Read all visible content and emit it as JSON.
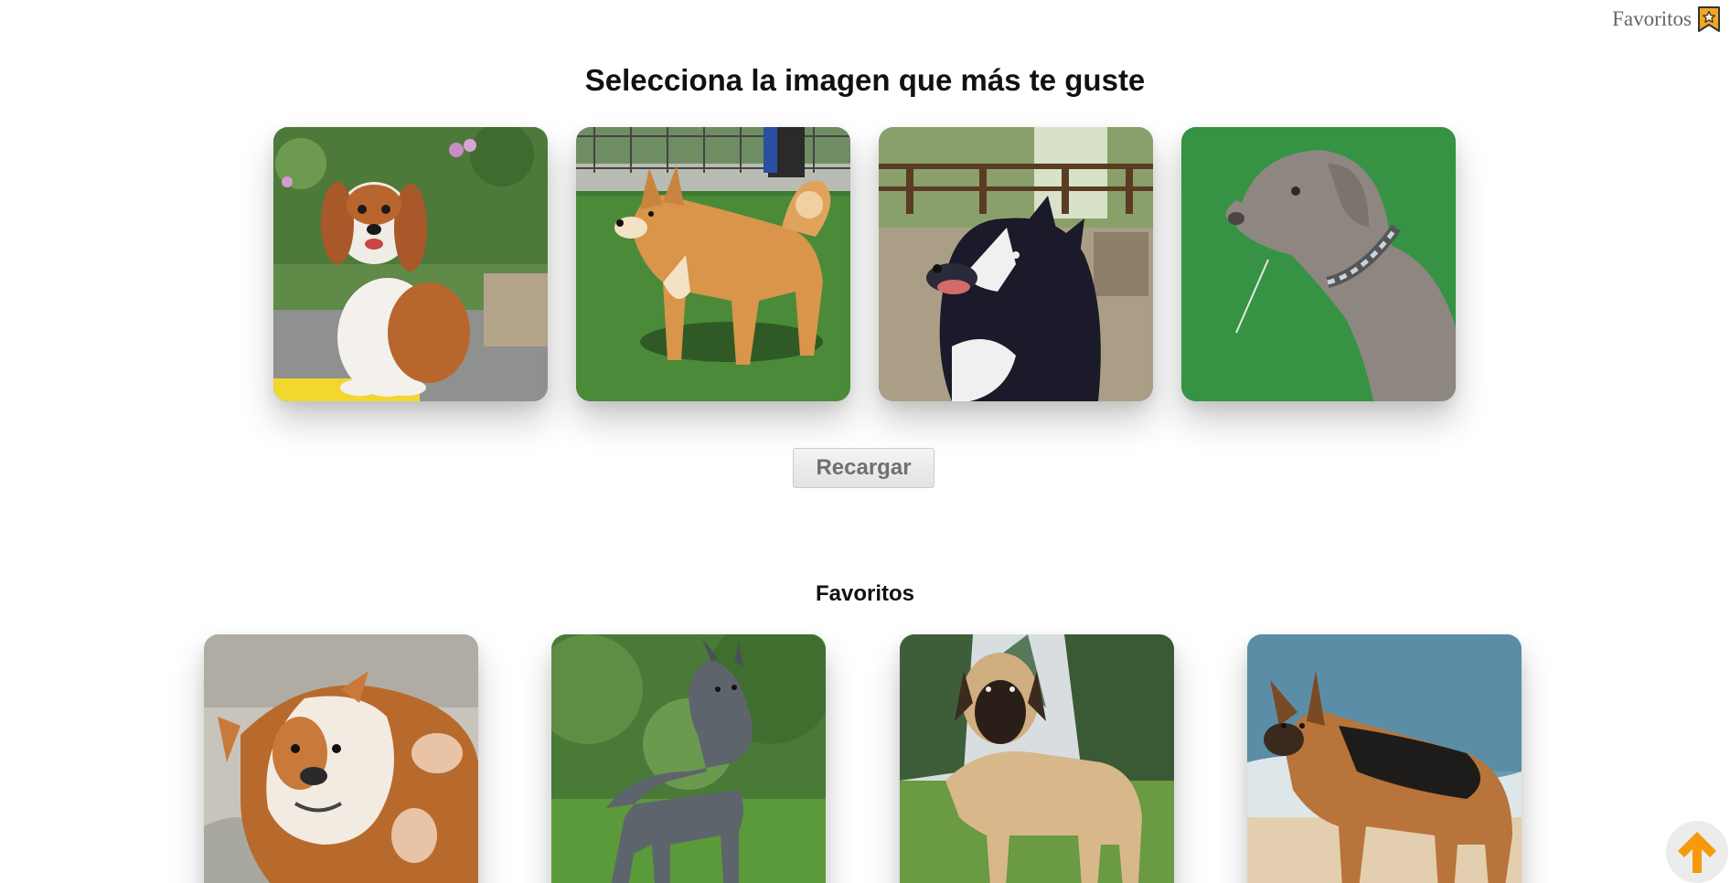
{
  "header": {
    "favorites_link_label": "Favoritos",
    "favorites_icon": "star-bookmark-icon",
    "accent_color": "#f5a623"
  },
  "main": {
    "title": "Selecciona la imagen que más te guste",
    "random_images": [
      {
        "subject": "cavalier-king-charles-spaniel"
      },
      {
        "subject": "shiba-inu"
      },
      {
        "subject": "border-collie"
      },
      {
        "subject": "weimaraner"
      }
    ],
    "reload_label": "Recargar"
  },
  "favorites": {
    "title": "Favoritos",
    "images": [
      {
        "subject": "english-bulldog"
      },
      {
        "subject": "great-dane"
      },
      {
        "subject": "mastiff"
      },
      {
        "subject": "german-shepherd"
      }
    ]
  },
  "scroll_top": {
    "icon": "arrow-up-icon",
    "color": "#f59a0a"
  }
}
